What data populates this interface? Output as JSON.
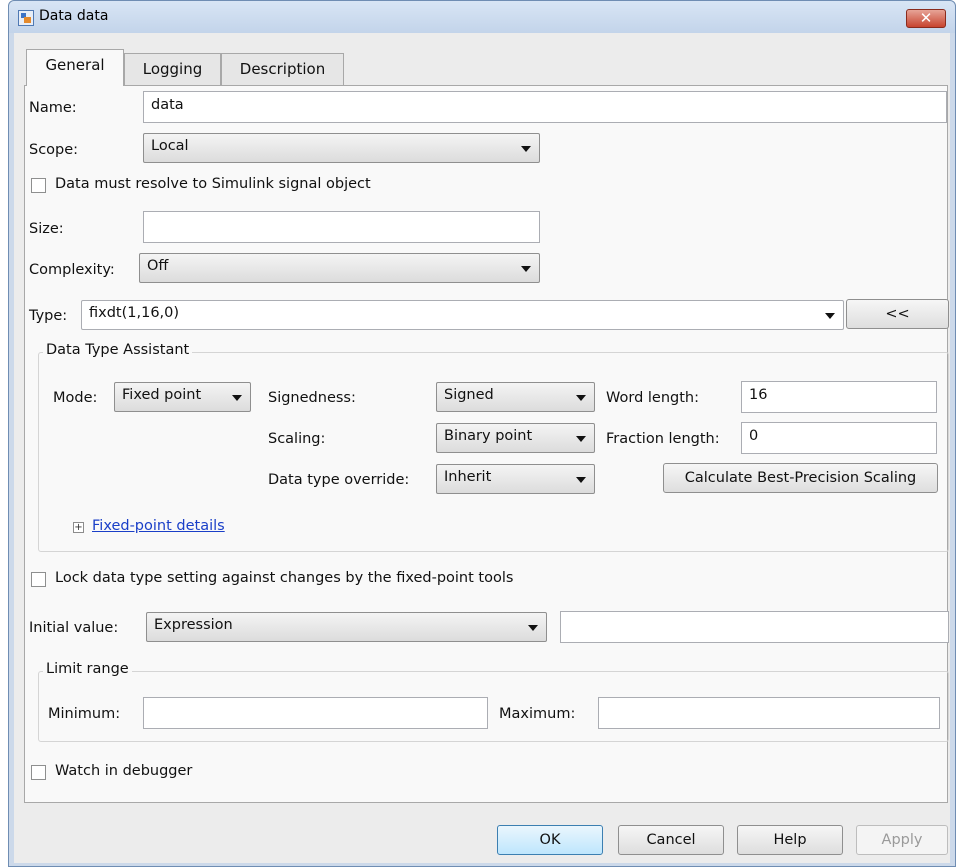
{
  "window": {
    "title": "Data data",
    "close_glyph": "✕"
  },
  "tabs": [
    {
      "label": "General",
      "active": true
    },
    {
      "label": "Logging",
      "active": false
    },
    {
      "label": "Description",
      "active": false
    }
  ],
  "general": {
    "name": {
      "label": "Name:",
      "value": "data"
    },
    "scope": {
      "label": "Scope:",
      "value": "Local"
    },
    "resolve_signal": {
      "label": "Data must resolve to Simulink signal object",
      "checked": false
    },
    "size": {
      "label": "Size:",
      "value": ""
    },
    "complexity": {
      "label": "Complexity:",
      "value": "Off"
    },
    "type": {
      "label": "Type:",
      "value": "fixdt(1,16,0)",
      "toggle_label": "<<"
    }
  },
  "assistant": {
    "title": "Data Type Assistant",
    "mode": {
      "label": "Mode:",
      "value": "Fixed point"
    },
    "signedness": {
      "label": "Signedness:",
      "value": "Signed"
    },
    "word_length": {
      "label": "Word length:",
      "value": "16"
    },
    "scaling": {
      "label": "Scaling:",
      "value": "Binary point"
    },
    "fraction_length": {
      "label": "Fraction length:",
      "value": "0"
    },
    "override": {
      "label": "Data type override:",
      "value": "Inherit"
    },
    "calc_button": "Calculate Best-Precision Scaling",
    "details_expander": "+",
    "details_link": "Fixed-point details"
  },
  "lock": {
    "label": "Lock data type setting against changes by the fixed-point tools",
    "checked": false
  },
  "initial_value": {
    "label": "Initial value:",
    "mode": "Expression",
    "value": ""
  },
  "limit_range": {
    "title": "Limit range",
    "minimum": {
      "label": "Minimum:",
      "value": ""
    },
    "maximum": {
      "label": "Maximum:",
      "value": ""
    }
  },
  "watch": {
    "label": "Watch in debugger",
    "checked": false
  },
  "buttons": {
    "ok": "OK",
    "cancel": "Cancel",
    "help": "Help",
    "apply": "Apply"
  }
}
